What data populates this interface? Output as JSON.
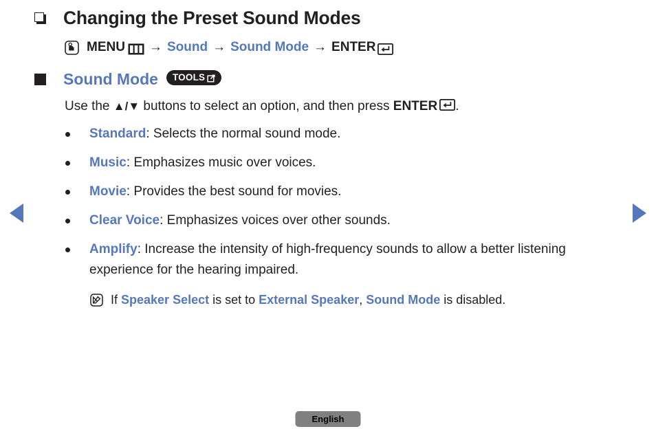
{
  "page": {
    "heading": "Changing the Preset Sound Modes",
    "section_title": "Sound Mode",
    "tools_badge_label": "TOOLS",
    "footer_language": "English"
  },
  "menu_path": {
    "press_icon": "press-hand-icon",
    "menu_label": "MENU",
    "menu_icon": "menu-grid-icon",
    "arrow": "→",
    "step_sound": "Sound",
    "step_sound_mode": "Sound Mode",
    "enter_label": "ENTER",
    "enter_icon": "enter-return-icon"
  },
  "instruction": {
    "prefix": "Use the ",
    "updown": "▲/▼",
    "middle": " buttons to select an option, and then press ",
    "enter_label": "ENTER",
    "suffix": "."
  },
  "options": [
    {
      "term": "Standard",
      "desc": ": Selects the normal sound mode."
    },
    {
      "term": "Music",
      "desc": ": Emphasizes music over voices."
    },
    {
      "term": "Movie",
      "desc": ": Provides the best sound for movies."
    },
    {
      "term": "Clear Voice",
      "desc": ": Emphasizes voices over other sounds."
    },
    {
      "term": "Amplify",
      "desc": ": Increase the intensity of high-frequency sounds to allow a better listening experience for the hearing impaired."
    }
  ],
  "note": {
    "icon": "note-pen-icon",
    "part1": "If ",
    "term1": "Speaker Select",
    "part2": " is set to ",
    "term2": "External Speaker",
    "part3": ", ",
    "term3": "Sound Mode",
    "part4": " is disabled."
  },
  "navigation": {
    "prev_icon": "triangle-left-icon",
    "next_icon": "triangle-right-icon"
  },
  "colors": {
    "accent_blue": "#5578bd",
    "text_black": "#231f20",
    "badge_gray": "#808080"
  }
}
